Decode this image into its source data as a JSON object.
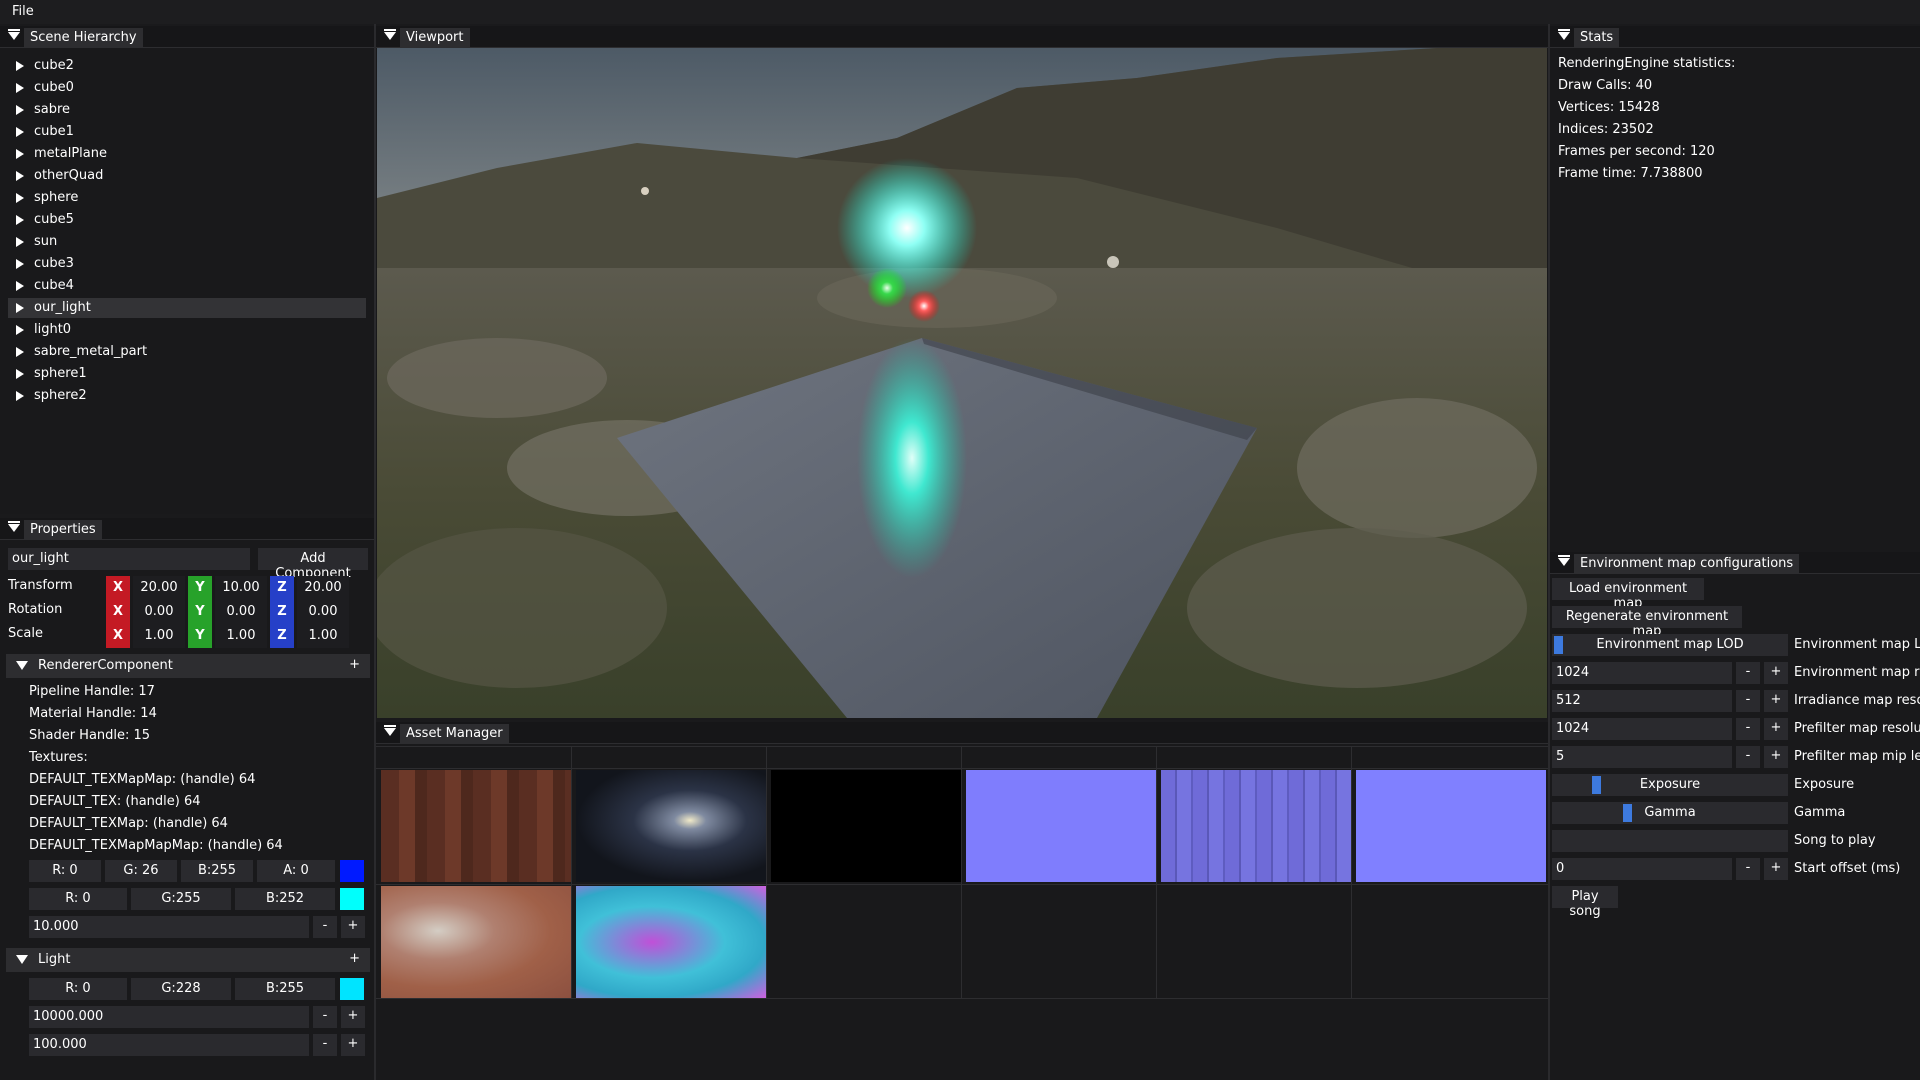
{
  "menu": {
    "file": "File"
  },
  "hierarchy": {
    "title": "Scene Hierarchy",
    "items": [
      "cube2",
      "cube0",
      "sabre",
      "cube1",
      "metalPlane",
      "otherQuad",
      "sphere",
      "cube5",
      "sun",
      "cube3",
      "cube4",
      "our_light",
      "light0",
      "sabre_metal_part",
      "sphere1",
      "sphere2"
    ],
    "selected": "our_light"
  },
  "properties": {
    "title": "Properties",
    "name_value": "our_light",
    "add_component": "Add Component",
    "transform_label": "Transform",
    "rotation_label": "Rotation",
    "scale_label": "Scale",
    "axis": {
      "x": "X",
      "y": "Y",
      "z": "Z"
    },
    "transform": [
      "20.00",
      "10.00",
      "20.00"
    ],
    "rotation": [
      "0.00",
      "0.00",
      "0.00"
    ],
    "scale": [
      "1.00",
      "1.00",
      "1.00"
    ],
    "renderer": {
      "title": "RendererComponent",
      "plus": "+",
      "lines": [
        "Pipeline Handle: 17",
        "Material Handle: 14",
        "Shader Handle: 15",
        "Textures:",
        "DEFAULT_TEXMapMap: (handle) 64",
        "DEFAULT_TEX: (handle) 64",
        "DEFAULT_TEXMap: (handle) 64",
        "DEFAULT_TEXMapMapMap: (handle) 64"
      ],
      "rgba": [
        "R: 0",
        "G: 26",
        "B:255",
        "A: 0"
      ],
      "rgba_color": "#001aff",
      "rgb2": [
        "R: 0",
        "G:255",
        "B:252"
      ],
      "rgb2_color": "#00fffc",
      "value": "10.000",
      "minus": "-",
      "plus_btn": "+"
    },
    "light": {
      "title": "Light",
      "plus": "+",
      "rgb": [
        "R: 0",
        "G:228",
        "B:255"
      ],
      "rgb_color": "#00e4ff",
      "value1": "10000.000",
      "value2": "100.000",
      "minus": "-",
      "plus_btn": "+"
    }
  },
  "viewport": {
    "title": "Viewport"
  },
  "assets": {
    "title": "Asset Manager"
  },
  "stats": {
    "title": "Stats",
    "lines": [
      "RenderingEngine statistics:",
      "Draw Calls: 40",
      "Vertices: 15428",
      "Indices: 23502",
      "Frames per second: 120",
      "Frame time: 7.738800"
    ]
  },
  "env": {
    "title": "Environment map configurations",
    "load": "Load environment map",
    "regen": "Regenerate environment map",
    "lod_slider": "Environment map LOD",
    "lod_label": "Environment map LOD",
    "res_value": "1024",
    "res_label": "Environment map resolution",
    "irr_value": "512",
    "irr_label": "Irradiance map resolution",
    "pref_value": "1024",
    "pref_label": "Prefilter map resolution",
    "mip_value": "5",
    "mip_label": "Prefilter map mip levels",
    "exposure_slider": "Exposure",
    "exposure_label": "Exposure",
    "exposure_level": 0.17,
    "gamma_slider": "Gamma",
    "gamma_label": "Gamma",
    "gamma_level": 0.31,
    "lod_level": 0.0,
    "song_label": "Song to play",
    "offset_value": "0",
    "offset_label": "Start offset (ms)",
    "play": "Play song",
    "minus": "-",
    "plus": "+"
  }
}
